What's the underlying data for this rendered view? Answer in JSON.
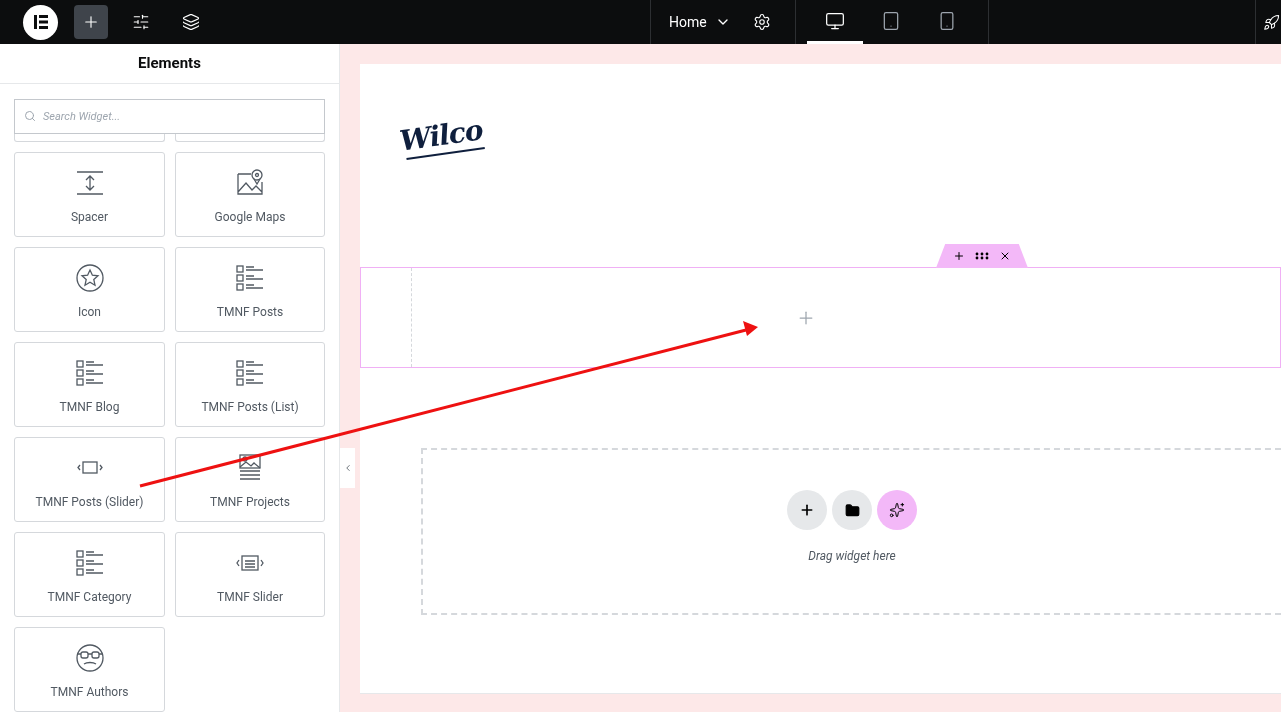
{
  "toolbar": {
    "items": [
      {
        "kind": "plus",
        "selected": true
      },
      {
        "kind": "sliders",
        "selected": false
      },
      {
        "kind": "layers",
        "selected": false
      }
    ]
  },
  "page_menu": {
    "label": "Home"
  },
  "devices": [
    {
      "kind": "desktop",
      "selected": true
    },
    {
      "kind": "tablet",
      "selected": false
    },
    {
      "kind": "mobile",
      "selected": false
    }
  ],
  "panel": {
    "title": "Elements",
    "search": {
      "placeholder": "Search Widget..."
    },
    "widgets": [
      {
        "kind": "spacer",
        "label": "Spacer"
      },
      {
        "kind": "map",
        "label": "Google Maps"
      },
      {
        "kind": "star",
        "label": "Icon"
      },
      {
        "kind": "list",
        "label": "TMNF Posts"
      },
      {
        "kind": "list",
        "label": "TMNF Blog"
      },
      {
        "kind": "list",
        "label": "TMNF Posts (List)"
      },
      {
        "kind": "slider",
        "label": "TMNF Posts (Slider)"
      },
      {
        "kind": "gallery",
        "label": "TMNF Projects"
      },
      {
        "kind": "list",
        "label": "TMNF Category"
      },
      {
        "kind": "banner",
        "label": "TMNF Slider"
      },
      {
        "kind": "face",
        "label": "TMNF Authors"
      }
    ]
  },
  "canvas": {
    "logo": "Wilco",
    "drop_zone": {
      "hint": "Drag widget here"
    }
  }
}
